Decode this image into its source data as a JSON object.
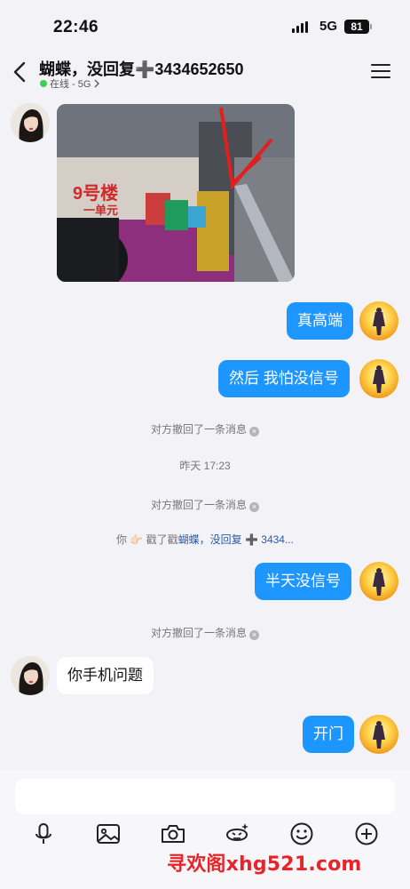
{
  "status_bar": {
    "time": "22:46",
    "network": "5G",
    "battery": "81"
  },
  "nav": {
    "title": "蝴蝶，没回复➕3434652650",
    "presence": "在线 - 5G"
  },
  "photo": {
    "sign_text": "9号楼",
    "sign_sub": "一单元"
  },
  "messages": {
    "m1": "真高端",
    "m2": "然后 我怕没信号",
    "sys_recall_1": "对方撤回了一条消息",
    "time_sep": "昨天 17:23",
    "sys_recall_2": "对方撤回了一条消息",
    "poke_prefix": "你 👉🏻 戳了戳",
    "poke_target": "蝴蝶，没回复 ➕ 3434...",
    "m3": "半天没信号",
    "sys_recall_3": "对方撤回了一条消息",
    "m4": "你手机问题",
    "m5": "开门"
  },
  "toolbar": {
    "icons": [
      "microphone-icon",
      "image-icon",
      "camera-icon",
      "sticker-icon",
      "emoji-icon",
      "plus-icon"
    ]
  },
  "watermark": "寻欢阁xhg521.com",
  "colors": {
    "bubble_self": "#1d96ff",
    "bubble_other": "#ffffff",
    "online": "#3ccf56",
    "watermark": "#e8242a"
  }
}
